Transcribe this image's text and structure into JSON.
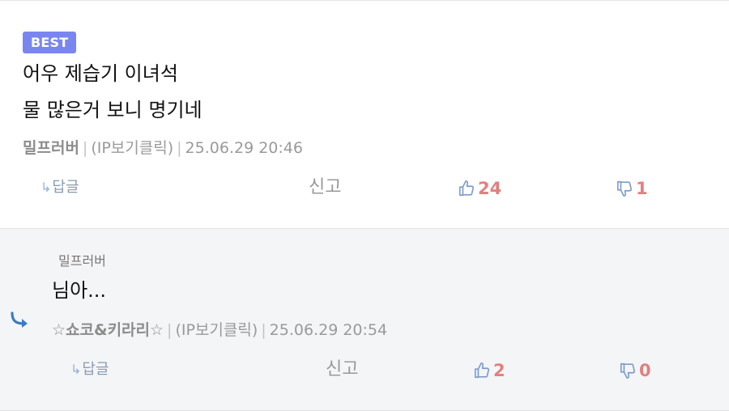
{
  "comments": [
    {
      "badge": "BEST",
      "lines": [
        "어우 제습기 이녀석",
        "물 많은거 보니 명기네"
      ],
      "author": "밀프러버",
      "ip": "(IP보기클릭)",
      "date": "25.06.29 20:46",
      "reply_label": "답글",
      "report_label": "신고",
      "likes": "24",
      "dislikes": "1"
    },
    {
      "parent_author": "밀프러버",
      "lines": [
        "님아..."
      ],
      "author": "☆쇼코&키라리☆",
      "ip": "(IP보기클릭)",
      "date": "25.06.29 20:54",
      "reply_label": "답글",
      "report_label": "신고",
      "likes": "2",
      "dislikes": "0"
    }
  ],
  "colors": {
    "badge": "#7a86ef",
    "vote_count": "#e27f7f",
    "thumb": "#7d9cc9",
    "reply_arrow": "#3a7cc3"
  },
  "icons": [
    "reply-arrow-icon",
    "thumbs-up-icon",
    "thumbs-down-icon"
  ]
}
